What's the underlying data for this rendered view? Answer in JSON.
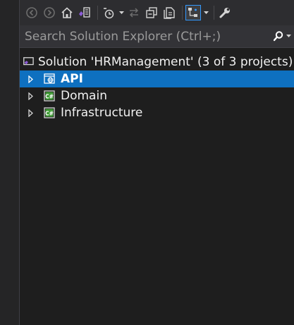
{
  "toolbar": {
    "buttons": [
      {
        "icon": "back-icon"
      },
      {
        "icon": "forward-icon"
      },
      {
        "icon": "home-icon"
      },
      {
        "icon": "switch-views-icon"
      },
      {
        "icon": "pending-changes-filter-icon"
      },
      {
        "icon": "sync-with-active-document-icon"
      },
      {
        "icon": "collapse-all-icon"
      },
      {
        "icon": "show-all-files-icon"
      },
      {
        "icon": "preview-selected-items-icon",
        "active": true
      },
      {
        "icon": "properties-icon"
      }
    ]
  },
  "search": {
    "placeholder": "Search Solution Explorer (Ctrl+;)",
    "value": ""
  },
  "tree": {
    "solution": {
      "label": "Solution 'HRManagement' (3 of 3 projects)",
      "icon": "solution-icon"
    },
    "projects": [
      {
        "label": "API",
        "icon": "web-project-icon",
        "selected": true
      },
      {
        "label": "Domain",
        "icon": "csharp-project-icon",
        "selected": false
      },
      {
        "label": "Infrastructure",
        "icon": "csharp-project-icon",
        "selected": false
      }
    ]
  },
  "colors": {
    "background": "#1e1e1e",
    "toolbar": "#2d2d30",
    "search_bar": "#333337",
    "selection": "#0e70c0",
    "text": "#f1f1f1",
    "accent": "#3399ff",
    "vs_purple": "#8c5bd8",
    "csharp_green": "#3f9c35"
  }
}
